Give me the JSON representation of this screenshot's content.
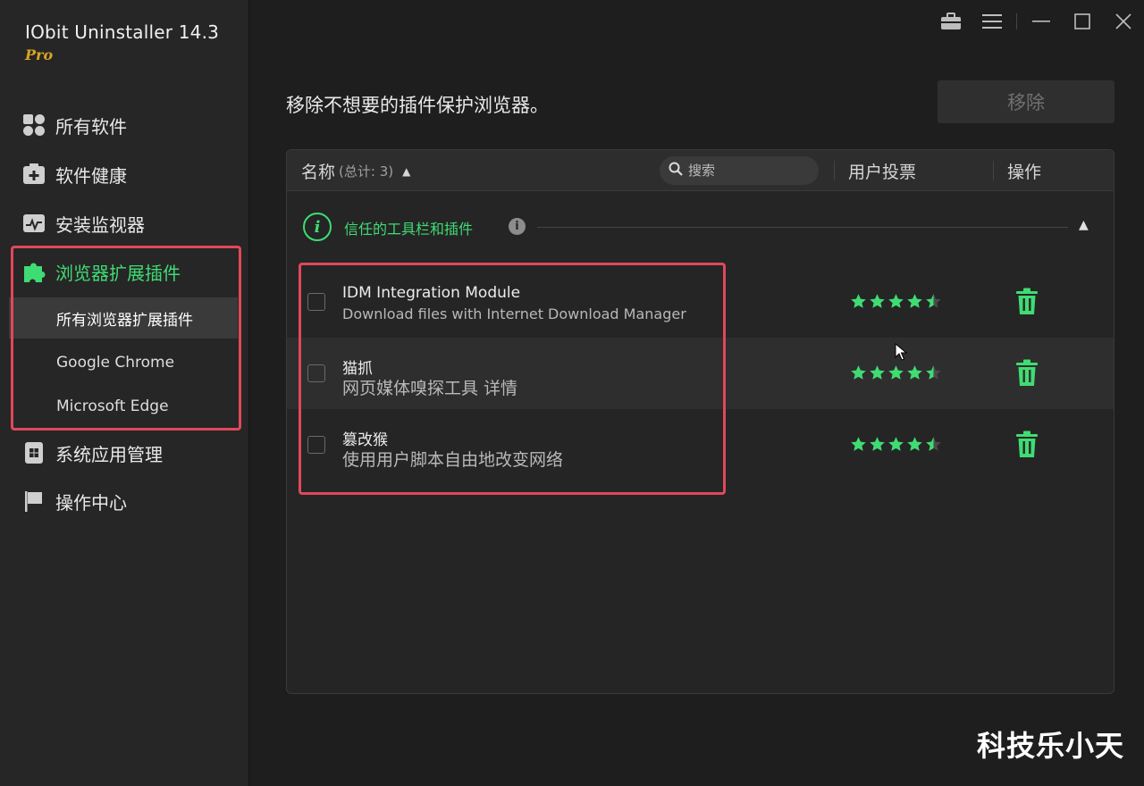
{
  "app": {
    "title": "IObit Uninstaller 14.3",
    "edition": "Pro"
  },
  "sidebar": {
    "items": [
      {
        "label": "所有软件",
        "icon": "grid-apps-icon"
      },
      {
        "label": "软件健康",
        "icon": "health-kit-icon"
      },
      {
        "label": "安装监视器",
        "icon": "monitor-pulse-icon"
      },
      {
        "label": "浏览器扩展插件",
        "icon": "puzzle-piece-icon",
        "active": true
      },
      {
        "label": "系统应用管理",
        "icon": "windows-app-icon"
      },
      {
        "label": "操作中心",
        "icon": "flag-icon"
      }
    ],
    "sub_items": [
      {
        "label": "所有浏览器扩展插件",
        "selected": true
      },
      {
        "label": "Google Chrome"
      },
      {
        "label": "Microsoft Edge"
      }
    ]
  },
  "window_controls": [
    "toolbox-icon",
    "menu-icon",
    "minimize-icon",
    "maximize-icon",
    "close-icon"
  ],
  "main": {
    "headline": "移除不想要的插件保护浏览器。",
    "remove_label": "移除",
    "table": {
      "name_header": "名称",
      "count_label": "(总计: 3)",
      "search_placeholder": "搜索",
      "votes_header": "用户投票",
      "action_header": "操作"
    },
    "group": {
      "label": "信任的工具栏和插件",
      "icon_letter": "i",
      "info_letter": "i"
    },
    "extensions": [
      {
        "name": "IDM Integration Module",
        "description": "Download files with Internet Download Manager",
        "rating": 4.5
      },
      {
        "name": "猫抓",
        "description": "网页媒体嗅探工具  详情",
        "rating": 4.5
      },
      {
        "name": "篡改猴",
        "description": "使用用户脚本自由地改变网络",
        "rating": 4.5
      }
    ]
  },
  "watermark": "科技乐小天",
  "colors": {
    "accent": "#3fdc73",
    "highlight": "#e0485a",
    "pro_badge": "#d9a520",
    "background": "#1e1e1e",
    "sidebar": "#262626"
  }
}
